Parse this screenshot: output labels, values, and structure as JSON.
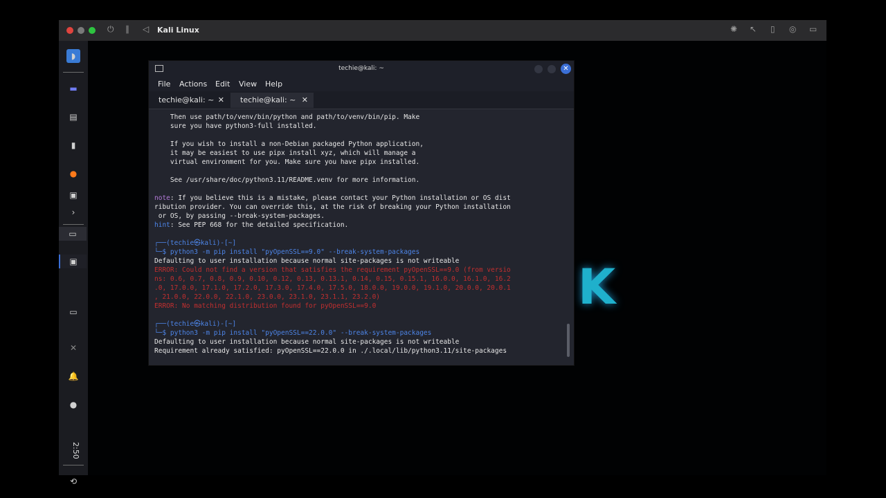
{
  "vm": {
    "title": "Kali Linux"
  },
  "panel": {
    "clock": "2:50"
  },
  "terminal": {
    "title": "techie@kali: ~",
    "menu": [
      "File",
      "Actions",
      "Edit",
      "View",
      "Help"
    ],
    "tabs": [
      "techie@kali: ~",
      "techie@kali: ~"
    ],
    "lines": [
      [
        "    Then use path/to/venv/bin/python and path/to/venv/bin/pip. Make"
      ],
      [
        "    sure you have python3-full installed."
      ],
      [
        ""
      ],
      [
        "    If you wish to install a non-Debian packaged Python application,"
      ],
      [
        "    it may be easiest to use pipx install xyz, which will manage a"
      ],
      [
        "    virtual environment for you. Make sure you have pipx installed."
      ],
      [
        ""
      ],
      [
        "    See /usr/share/doc/python3.11/README.venv for more information."
      ],
      [
        ""
      ],
      [
        "note",
        ": If you believe this is a mistake, please contact your Python installation or OS dist"
      ],
      [
        "ribution provider. You can override this, at the risk of breaking your Python installation"
      ],
      [
        " or OS, by passing --break-system-packages."
      ],
      [
        "hint",
        ": See PEP 668 for the detailed specification."
      ],
      [
        ""
      ],
      [
        "┌──(techie㉿kali)-[~]"
      ],
      [
        "└─$ python3 -m pip install \"pyOpenSSL==9.0\" --break-system-packages"
      ],
      [
        "Defaulting to user installation because normal site-packages is not writeable"
      ],
      [
        "ERROR: Could not find a version that satisfies the requirement pyOpenSSL==9.0 (from versio"
      ],
      [
        "ns: 0.6, 0.7, 0.8, 0.9, 0.10, 0.12, 0.13, 0.13.1, 0.14, 0.15, 0.15.1, 16.0.0, 16.1.0, 16.2"
      ],
      [
        ".0, 17.0.0, 17.1.0, 17.2.0, 17.3.0, 17.4.0, 17.5.0, 18.0.0, 19.0.0, 19.1.0, 20.0.0, 20.0.1"
      ],
      [
        ", 21.0.0, 22.0.0, 22.1.0, 23.0.0, 23.1.0, 23.1.1, 23.2.0)"
      ],
      [
        "ERROR: No matching distribution found for pyOpenSSL==9.0"
      ],
      [
        ""
      ],
      [
        "┌──(techie㉿kali)-[~]"
      ],
      [
        "└─$ python3 -m pip install \"pyOpenSSL==22.0.0\" --break-system-packages"
      ],
      [
        "Defaulting to user installation because normal site-packages is not writeable"
      ],
      [
        "Requirement already satisfied: pyOpenSSL==22.0.0 in ./.local/lib/python3.11/site-packages"
      ]
    ]
  },
  "colors": {
    "accent": "#3b6fd6",
    "error": "#c22f2f",
    "prompt": "#4d85e8",
    "note": "#b37ad8"
  }
}
